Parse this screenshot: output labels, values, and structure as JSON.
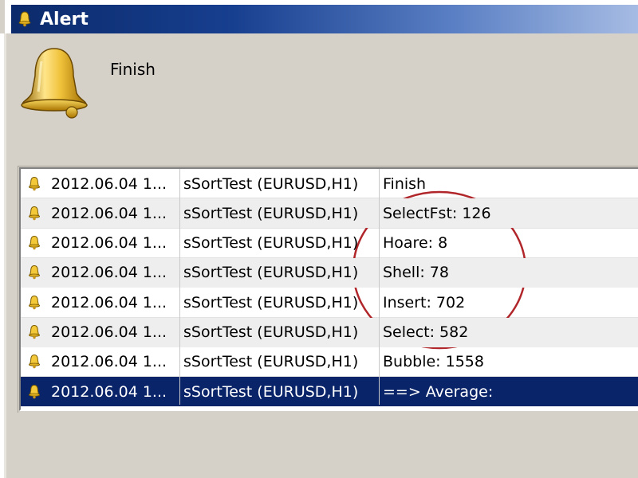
{
  "window": {
    "title": "Alert",
    "icon": "bell-icon"
  },
  "alert": {
    "message": "Finish",
    "icon": "bell-icon"
  },
  "list": {
    "rows": [
      {
        "time": "2012.06.04 1...",
        "source": "sSortTest (EURUSD,H1)",
        "text": "Finish",
        "selected": false
      },
      {
        "time": "2012.06.04 1...",
        "source": "sSortTest (EURUSD,H1)",
        "text": "SelectFst: 126",
        "selected": false
      },
      {
        "time": "2012.06.04 1...",
        "source": "sSortTest (EURUSD,H1)",
        "text": "Hoare: 8",
        "selected": false
      },
      {
        "time": "2012.06.04 1...",
        "source": "sSortTest (EURUSD,H1)",
        "text": "Shell: 78",
        "selected": false
      },
      {
        "time": "2012.06.04 1...",
        "source": "sSortTest (EURUSD,H1)",
        "text": "Insert: 702",
        "selected": false
      },
      {
        "time": "2012.06.04 1...",
        "source": "sSortTest (EURUSD,H1)",
        "text": "Select: 582",
        "selected": false
      },
      {
        "time": "2012.06.04 1...",
        "source": "sSortTest (EURUSD,H1)",
        "text": "Bubble: 1558",
        "selected": false
      },
      {
        "time": "2012.06.04 1...",
        "source": "sSortTest (EURUSD,H1)",
        "text": "==> Average:",
        "selected": true
      }
    ]
  },
  "colors": {
    "titlebar": "#0b2a6b",
    "selection": "#0a246a",
    "annotation": "#b0262a",
    "window_bg": "#d5d1c9"
  }
}
